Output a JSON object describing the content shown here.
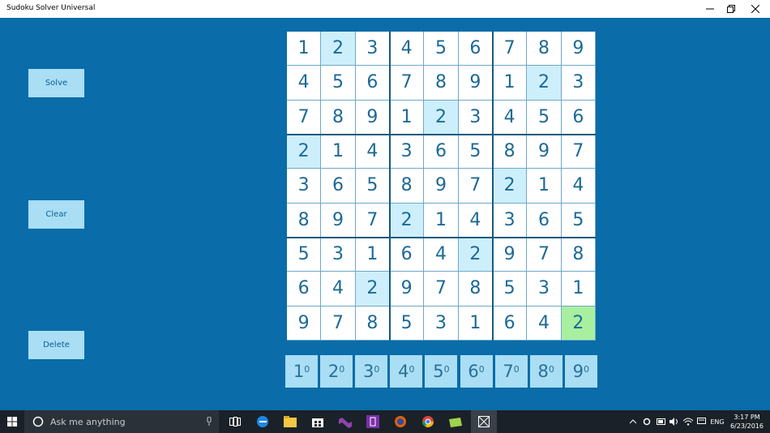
{
  "window": {
    "title": "Sudoku Solver Universal"
  },
  "sidebar": {
    "solve_label": "Solve",
    "clear_label": "Clear",
    "delete_label": "Delete"
  },
  "grid": {
    "rows": [
      [
        1,
        2,
        3,
        4,
        5,
        6,
        7,
        8,
        9
      ],
      [
        4,
        5,
        6,
        7,
        8,
        9,
        1,
        2,
        3
      ],
      [
        7,
        8,
        9,
        1,
        2,
        3,
        4,
        5,
        6
      ],
      [
        2,
        1,
        4,
        3,
        6,
        5,
        8,
        9,
        7
      ],
      [
        3,
        6,
        5,
        8,
        9,
        7,
        2,
        1,
        4
      ],
      [
        8,
        9,
        7,
        2,
        1,
        4,
        3,
        6,
        5
      ],
      [
        5,
        3,
        1,
        6,
        4,
        2,
        9,
        7,
        8
      ],
      [
        6,
        4,
        2,
        9,
        7,
        8,
        5,
        3,
        1
      ],
      [
        9,
        7,
        8,
        5,
        3,
        1,
        6,
        4,
        2
      ]
    ],
    "highlighted": [
      [
        0,
        1
      ],
      [
        1,
        7
      ],
      [
        2,
        4
      ],
      [
        3,
        0
      ],
      [
        4,
        6
      ],
      [
        5,
        3
      ],
      [
        6,
        5
      ],
      [
        7,
        2
      ]
    ],
    "selected": [
      8,
      8
    ],
    "colors": {
      "highlight": "#cdeffb",
      "selected": "#a8f0a0",
      "text": "#1c6a96"
    }
  },
  "number_buttons": [
    {
      "digit": "1",
      "count": "0"
    },
    {
      "digit": "2",
      "count": "0"
    },
    {
      "digit": "3",
      "count": "0"
    },
    {
      "digit": "4",
      "count": "0"
    },
    {
      "digit": "5",
      "count": "0"
    },
    {
      "digit": "6",
      "count": "0"
    },
    {
      "digit": "7",
      "count": "0"
    },
    {
      "digit": "8",
      "count": "0"
    },
    {
      "digit": "9",
      "count": "0"
    }
  ],
  "taskbar": {
    "search_placeholder": "Ask me anything",
    "language": "ENG",
    "time": "3:17 PM",
    "date": "6/23/2016",
    "pinned_icons": [
      "task-view-icon",
      "edge-icon",
      "file-explorer-icon",
      "store-icon",
      "visual-studio-icon",
      "app-icon",
      "firefox-icon",
      "chrome-icon",
      "folder-icon",
      "sudoku-app-icon"
    ]
  },
  "colors": {
    "background": "#0a6ca8",
    "button": "#a9def5"
  }
}
